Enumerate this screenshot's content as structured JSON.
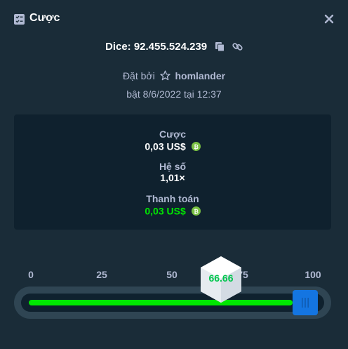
{
  "header": {
    "title": "Cược",
    "icon": "bet-slip-icon",
    "close_icon": "close-icon"
  },
  "bet": {
    "dice_id": "Dice: 92.455.524.239",
    "placed_by_label": "Đặt bởi",
    "username": "homlander",
    "placed_at": "bật 8/6/2022 tại 12:37"
  },
  "stats": {
    "bet_label": "Cược",
    "bet_value": "0,03 US$",
    "multiplier_label": "Hệ số",
    "multiplier_value": "1,01×",
    "payout_label": "Thanh toán",
    "payout_value": "0,03 US$",
    "currency_icon": "bitcoin-icon"
  },
  "slider": {
    "ticks": [
      "0",
      "25",
      "50",
      "75",
      "100"
    ],
    "result": "66.66",
    "target_fraction": 0.9439
  },
  "colors": {
    "background": "#1a2c38",
    "card": "#0f212e",
    "accent_green": "#00e701",
    "handle_blue": "#1475e1",
    "muted_text": "#b1bad3"
  }
}
